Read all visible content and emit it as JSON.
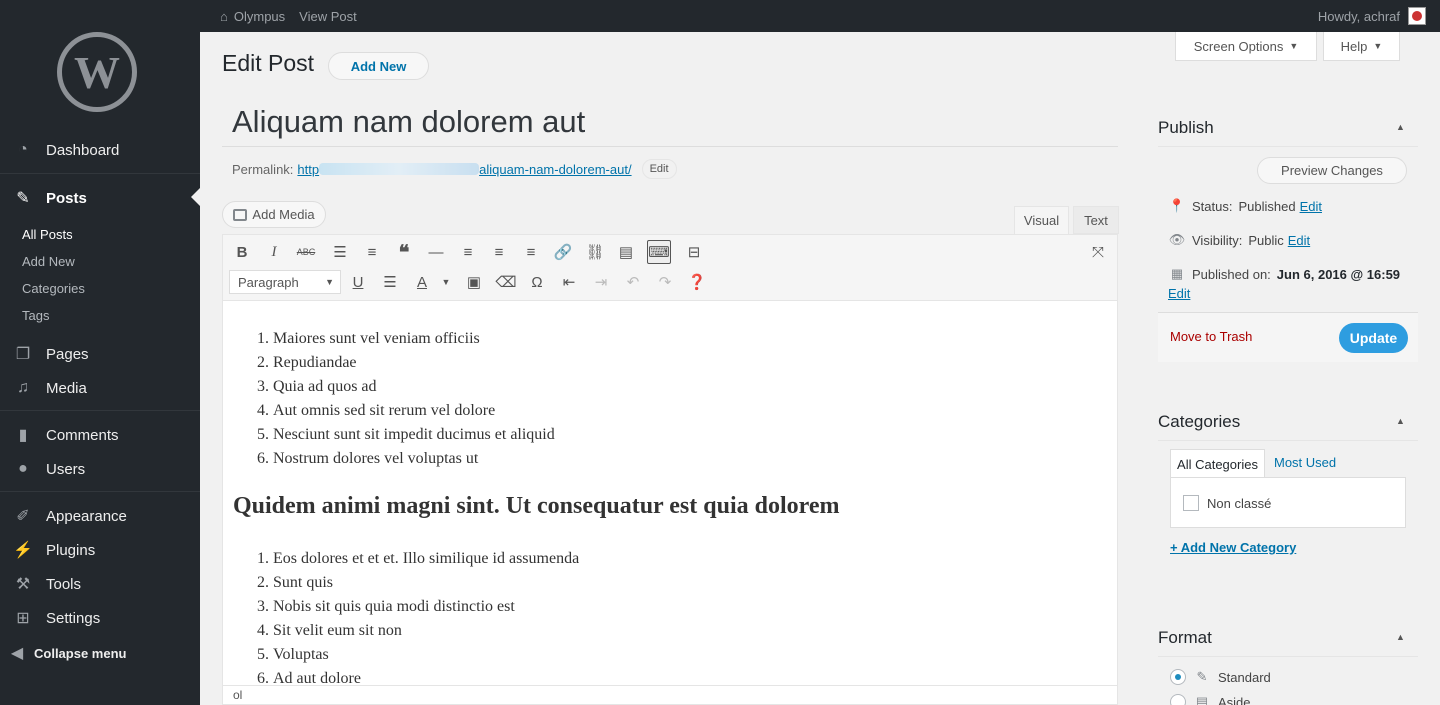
{
  "adminbar": {
    "site_name": "Olympus",
    "view_post": "View Post",
    "howdy": "Howdy, achraf"
  },
  "sidebar": {
    "items": [
      {
        "label": "Dashboard",
        "icon": "dashboard-icon"
      },
      {
        "label": "Posts",
        "icon": "pin-icon"
      },
      {
        "label": "Pages",
        "icon": "pages-icon"
      },
      {
        "label": "Media",
        "icon": "media-icon"
      },
      {
        "label": "Comments",
        "icon": "comment-icon"
      },
      {
        "label": "Users",
        "icon": "user-icon"
      },
      {
        "label": "Appearance",
        "icon": "brush-icon"
      },
      {
        "label": "Plugins",
        "icon": "plug-icon"
      },
      {
        "label": "Tools",
        "icon": "wrench-icon"
      },
      {
        "label": "Settings",
        "icon": "settings-icon"
      },
      {
        "label": "Collapse menu",
        "icon": "collapse-icon"
      }
    ],
    "posts_submenu": [
      "All Posts",
      "Add New",
      "Categories",
      "Tags"
    ]
  },
  "header": {
    "screen_options": "Screen Options",
    "help": "Help",
    "page_title": "Edit Post",
    "add_new": "Add New"
  },
  "editor": {
    "title_value": "Aliquam nam dolorem aut",
    "permalink_label": "Permalink:",
    "permalink_prefix": "http",
    "permalink_slug": "aliquam-nam-dolorem-aut/",
    "permalink_edit": "Edit",
    "add_media": "Add Media",
    "tab_visual": "Visual",
    "tab_text": "Text",
    "format_select": "Paragraph",
    "list1": [
      "Maiores sunt vel veniam officiis",
      "Repudiandae",
      "Quia ad quos ad",
      "Aut omnis sed sit rerum vel dolore",
      "Nesciunt sunt sit impedit ducimus et aliquid",
      "Nostrum dolores vel voluptas ut"
    ],
    "heading": "Quidem animi magni sint. Ut consequatur est quia dolorem",
    "list2": [
      "Eos dolores et et et. Illo similique id assumenda",
      "Sunt quis",
      "Nobis sit quis quia modi distinctio est",
      "Sit velit eum sit non",
      "Voluptas",
      "Ad aut dolore"
    ],
    "status_path": "ol"
  },
  "publish": {
    "title": "Publish",
    "preview": "Preview Changes",
    "status_label": "Status:",
    "status_value": "Published",
    "visibility_label": "Visibility:",
    "visibility_value": "Public",
    "published_label": "Published on:",
    "published_value": "Jun 6, 2016 @ 16:59",
    "edit": "Edit",
    "trash": "Move to Trash",
    "update": "Update"
  },
  "categories": {
    "title": "Categories",
    "tab_all": "All Categories",
    "tab_used": "Most Used",
    "items": [
      "Non classé"
    ],
    "add_new": "+ Add New Category"
  },
  "format": {
    "title": "Format",
    "options": [
      "Standard",
      "Aside"
    ],
    "selected": "Standard"
  }
}
